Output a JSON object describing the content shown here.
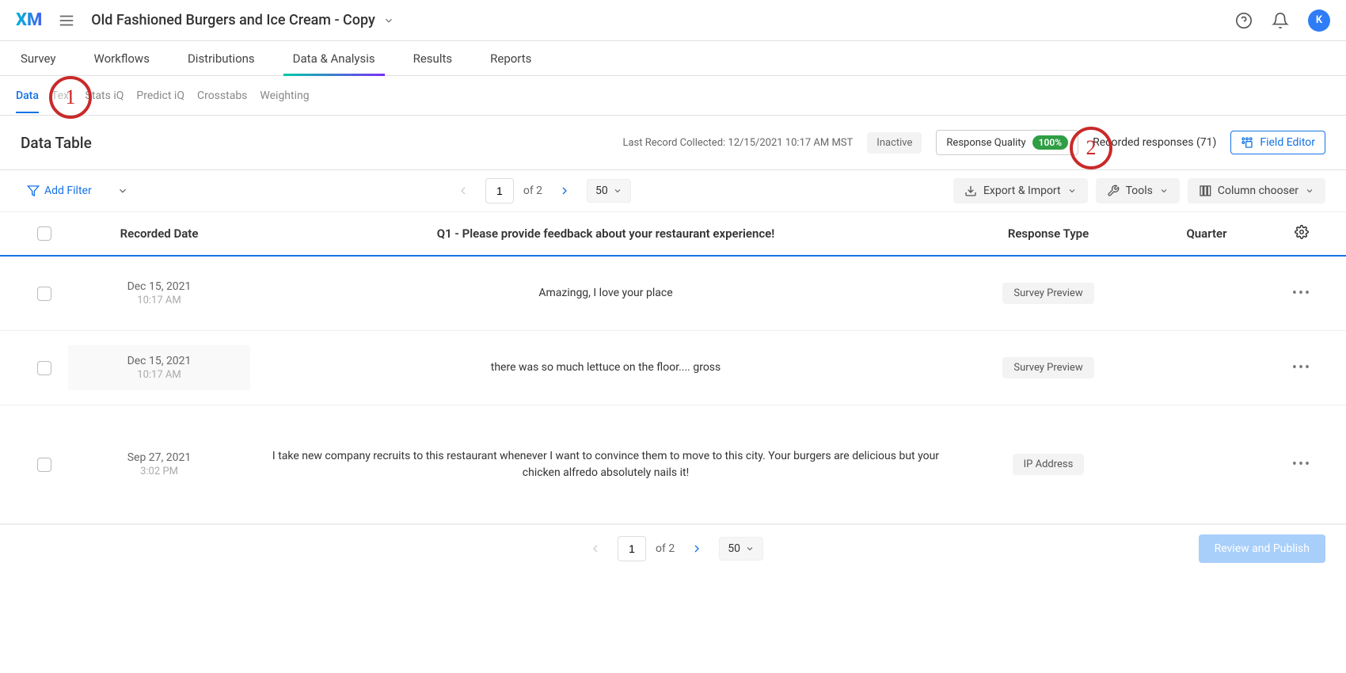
{
  "header": {
    "logo": "XM",
    "project_title": "Old Fashioned Burgers and Ice Cream - Copy",
    "avatar_initial": "K"
  },
  "main_tabs": [
    "Survey",
    "Workflows",
    "Distributions",
    "Data & Analysis",
    "Results",
    "Reports"
  ],
  "main_tab_active": 3,
  "sub_tabs": [
    {
      "label": "Data",
      "active": true
    },
    {
      "label": "Text",
      "disabled": true
    },
    {
      "label": "Stats iQ"
    },
    {
      "label": "Predict iQ"
    },
    {
      "label": "Crosstabs"
    },
    {
      "label": "Weighting"
    }
  ],
  "callouts": {
    "c1": "1",
    "c2": "2"
  },
  "section": {
    "title": "Data Table",
    "last_record_label": "Last Record Collected: 12/15/2021 10:17 AM MST",
    "inactive_label": "Inactive",
    "quality_label": "Response Quality",
    "quality_badge": "100%",
    "recorded_label": "Recorded responses (71)",
    "field_editor_label": "Field Editor"
  },
  "toolbar": {
    "add_filter": "Add Filter",
    "page_current": "1",
    "page_of": "of 2",
    "page_size": "50",
    "export_import": "Export & Import",
    "tools": "Tools",
    "column_chooser": "Column chooser"
  },
  "columns": {
    "recorded_date": "Recorded Date",
    "q1": "Q1 - Please provide feedback about your restaurant experience!",
    "response_type": "Response Type",
    "quarter": "Quarter"
  },
  "rows": [
    {
      "date": "Dec 15, 2021",
      "time": "10:17 AM",
      "feedback": "Amazingg, I love your place",
      "type": "Survey Preview",
      "quarter": ""
    },
    {
      "date": "Dec 15, 2021",
      "time": "10:17 AM",
      "feedback": "there was so much lettuce on the floor.... gross",
      "type": "Survey Preview",
      "quarter": ""
    },
    {
      "date": "Sep 27, 2021",
      "time": "3:02 PM",
      "feedback": "I take new company recruits to this restaurant whenever I want to convince them to move to this city. Your burgers are delicious but your chicken alfredo absolutely nails it!",
      "type": "IP Address",
      "quarter": ""
    }
  ],
  "footer": {
    "page_current": "1",
    "page_of": "of 2",
    "page_size": "50",
    "review_label": "Review and Publish"
  }
}
